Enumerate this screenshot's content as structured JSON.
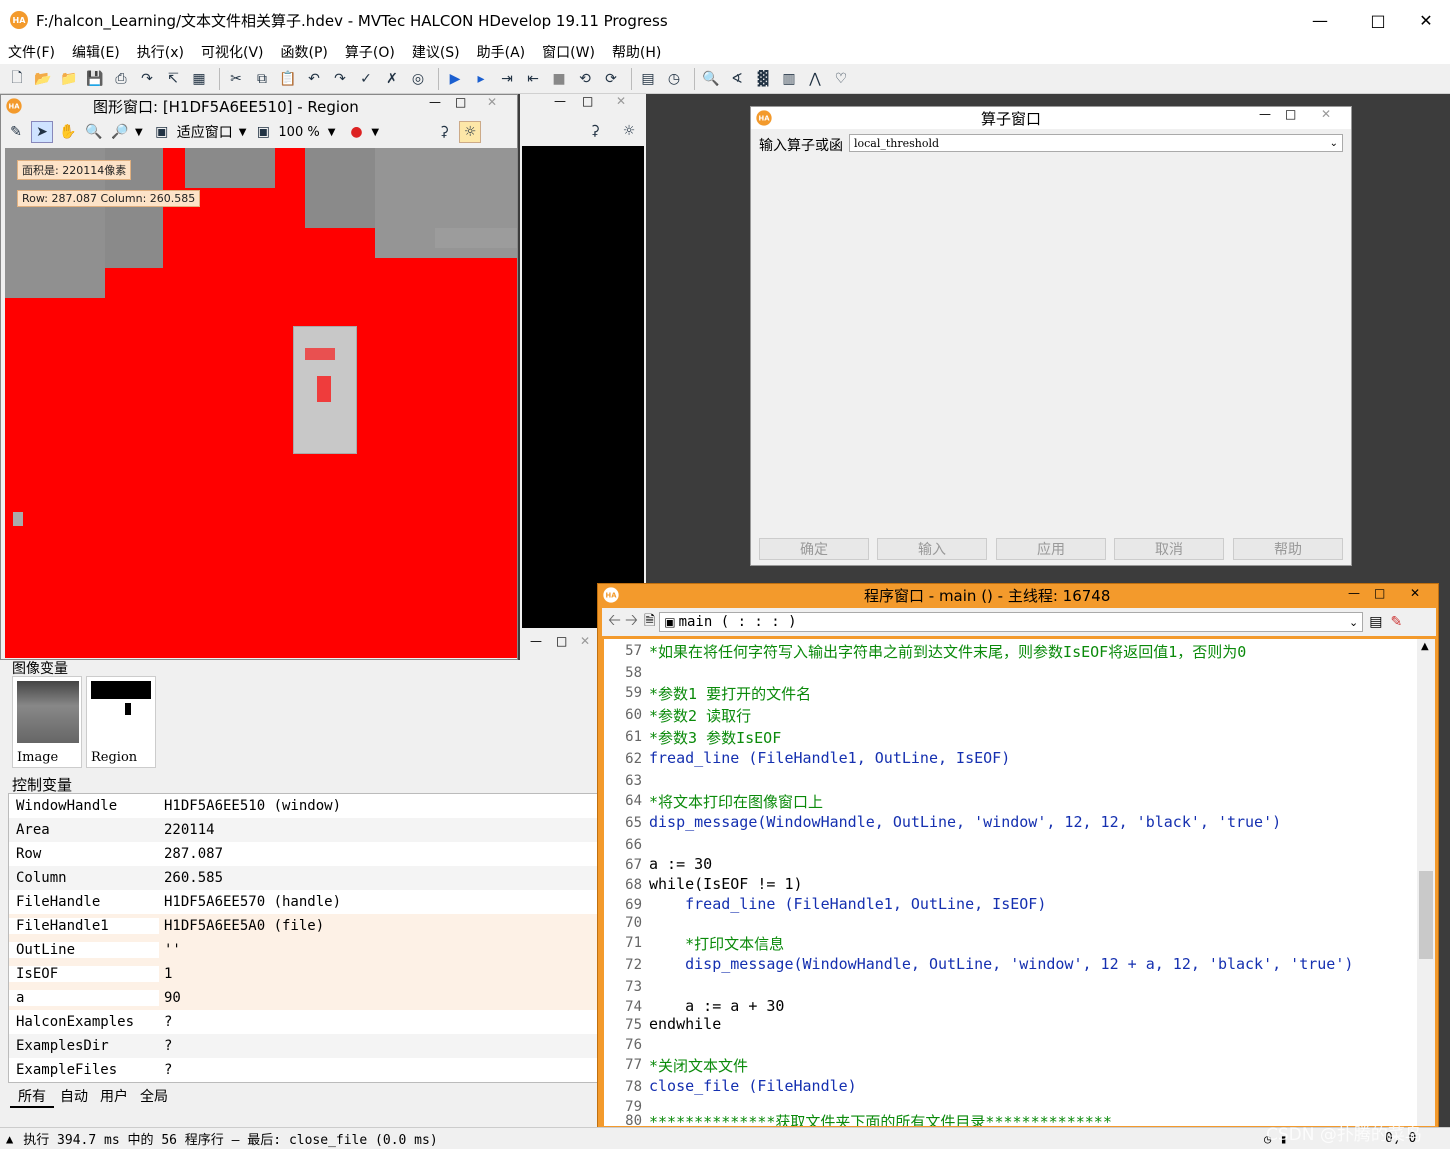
{
  "app": {
    "title": "F:/halcon_Learning/文本文件相关算子.hdev - MVTec HALCON HDevelop 19.11 Progress",
    "logo": "HA"
  },
  "menu": [
    "文件(F)",
    "编辑(E)",
    "执行(x)",
    "可视化(V)",
    "函数(P)",
    "算子(O)",
    "建议(S)",
    "助手(A)",
    "窗口(W)",
    "帮助(H)"
  ],
  "graphics": {
    "title": "图形窗口: [H1DF5A6EE510] - Region",
    "fit": "适应窗口",
    "zoom": "100 %",
    "area_label": "面积是: 220114像素",
    "pos_label": "Row: 287.087 Column: 260.585"
  },
  "image_vars": {
    "title": "图像变量",
    "items": [
      "Image",
      "Region"
    ]
  },
  "control_vars": {
    "title": "控制变量",
    "rows": [
      {
        "name": "WindowHandle",
        "value": "H1DF5A6EE510 (window)"
      },
      {
        "name": "Area",
        "value": "220114"
      },
      {
        "name": "Row",
        "value": "287.087"
      },
      {
        "name": "Column",
        "value": "260.585"
      },
      {
        "name": "FileHandle",
        "value": "H1DF5A6EE570 (handle)"
      },
      {
        "name": "FileHandle1",
        "value": "H1DF5A6EE5A0 (file)"
      },
      {
        "name": "OutLine",
        "value": "''"
      },
      {
        "name": "IsEOF",
        "value": "1"
      },
      {
        "name": "a",
        "value": "90"
      },
      {
        "name": "HalconExamples",
        "value": "?"
      },
      {
        "name": "ExamplesDir",
        "value": "?"
      },
      {
        "name": "ExampleFiles",
        "value": "?"
      }
    ],
    "tabs": [
      "所有",
      "自动",
      "用户",
      "全局"
    ]
  },
  "operator": {
    "title": "算子窗口",
    "label": "输入算子或函",
    "value": "local_threshold",
    "buttons": [
      "确定",
      "输入",
      "应用",
      "取消",
      "帮助"
    ]
  },
  "program": {
    "title": "程序窗口 - main () - 主线程: 16748",
    "proc": "main ( : : : )",
    "lines": [
      {
        "n": "57",
        "text": "*如果在将任何字符写入输出字符串之前到达文件末尾，则参数IsEOF将返回值1，否则为0",
        "type": "cm"
      },
      {
        "n": "58",
        "text": "",
        "type": "cm"
      },
      {
        "n": "59",
        "text": "*参数1 要打开的文件名",
        "type": "cm"
      },
      {
        "n": "60",
        "text": "*参数2 读取行",
        "type": "cm"
      },
      {
        "n": "61",
        "text": "*参数3 参数IsEOF",
        "type": "cm"
      },
      {
        "n": "62",
        "text": "fread_line (FileHandle1, OutLine, IsEOF)",
        "type": "op"
      },
      {
        "n": "63",
        "text": "",
        "type": "cm"
      },
      {
        "n": "64",
        "text": "*将文本打印在图像窗口上",
        "type": "cm"
      },
      {
        "n": "65",
        "text": "disp_message(WindowHandle, OutLine, 'window', 12, 12, 'black', 'true')",
        "type": "op"
      },
      {
        "n": "66",
        "text": "",
        "type": "cm"
      },
      {
        "n": "67",
        "text": "a := 30",
        "type": "sy"
      },
      {
        "n": "68",
        "text": "while(IsEOF != 1)",
        "type": "sy"
      },
      {
        "n": "69",
        "text": "    fread_line (FileHandle1, OutLine, IsEOF)",
        "type": "op"
      },
      {
        "n": "70",
        "text": "",
        "type": "cm"
      },
      {
        "n": "71",
        "text": "    *打印文本信息",
        "type": "cm"
      },
      {
        "n": "72",
        "text": "    disp_message(WindowHandle, OutLine, 'window', 12 + a, 12, 'black', 'true')",
        "type": "op"
      },
      {
        "n": "73",
        "text": "",
        "type": "cm"
      },
      {
        "n": "74",
        "text": "    a := a + 30",
        "type": "sy"
      },
      {
        "n": "75",
        "text": "endwhile",
        "type": "sy"
      },
      {
        "n": "76",
        "text": "",
        "type": "cm"
      },
      {
        "n": "77",
        "text": "*关闭文本文件",
        "type": "cm"
      },
      {
        "n": "78",
        "text": "close_file (FileHandle)",
        "type": "op"
      },
      {
        "n": "79",
        "text": "",
        "type": "cm"
      },
      {
        "n": "80",
        "text": "**************获取文件夹下面的所有文件目录**************",
        "type": "cm"
      }
    ]
  },
  "status": {
    "text": "执行 394.7 ms 中的 56 程序行 — 最后: close_file (0.0 ms)",
    "coords": "0, 0"
  },
  "watermark": "CSDN @扑腾的菜鸟",
  "colors": {
    "accent": "#f39a2c",
    "region": "#ff0000",
    "comment": "#0a8a0a",
    "operator": "#1530b0"
  }
}
